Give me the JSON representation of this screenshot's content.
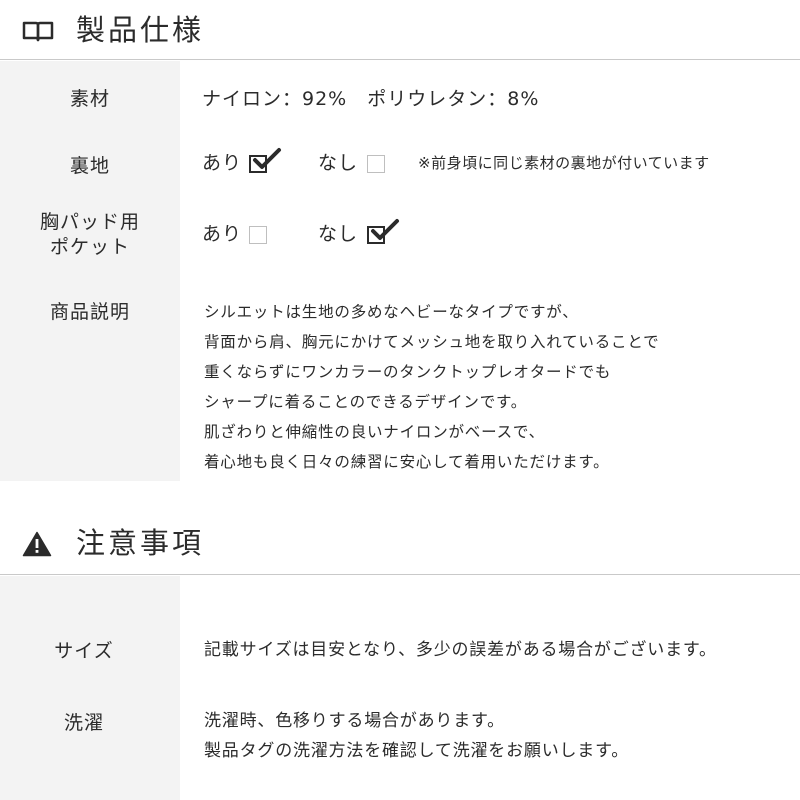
{
  "spec_section": {
    "icon": "book-icon",
    "title": "製品仕様",
    "material": {
      "label": "素材",
      "value": "ナイロン：92%　ポリウレタン：8%"
    },
    "lining": {
      "label": "裏地",
      "yes_label": "あり",
      "yes_checked": true,
      "no_label": "なし",
      "no_checked": false,
      "note": "※前身頃に同じ素材の裏地が付いています"
    },
    "pad_pocket": {
      "label_line1": "胸パッド用",
      "label_line2": "ポケット",
      "yes_label": "あり",
      "yes_checked": false,
      "no_label": "なし",
      "no_checked": true
    },
    "description": {
      "label": "商品説明",
      "lines": [
        "シルエットは生地の多めなヘビーなタイプですが、",
        "背面から肩、胸元にかけてメッシュ地を取り入れていることで",
        "重くならずにワンカラーのタンクトップレオタードでも",
        "シャープに着ることのできるデザインです。",
        "肌ざわりと伸縮性の良いナイロンがベースで、",
        "着心地も良く日々の練習に安心して着用いただけます。"
      ]
    }
  },
  "caution_section": {
    "icon": "warning-icon",
    "title": "注意事項",
    "size": {
      "label": "サイズ",
      "value": "記載サイズは目安となり、多少の誤差がある場合がございます。"
    },
    "washing": {
      "label": "洗濯",
      "lines": [
        "洗濯時、色移りする場合があります。",
        "製品タグの洗濯方法を確認して洗濯をお願いします。"
      ]
    }
  }
}
